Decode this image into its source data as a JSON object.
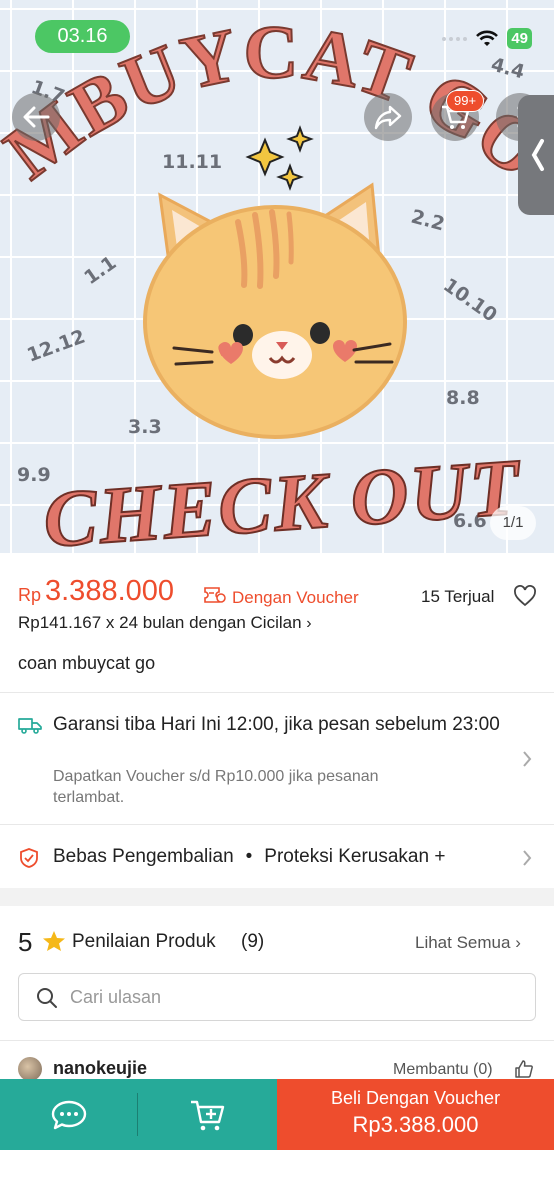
{
  "status_bar": {
    "time": "03.16",
    "battery": "49"
  },
  "hero": {
    "cart_badge": "99+",
    "image_counter": "1/1",
    "artwork_title_top": "MBUYCAT GO",
    "artwork_title_bottom": "CHECK OUT",
    "artwork_dates": [
      "1.1",
      "11.11",
      "2.2",
      "1.1",
      "10.10",
      "12.12",
      "8.8",
      "3.3",
      "9.9",
      "6.6",
      "4.4"
    ]
  },
  "product": {
    "currency": "Rp",
    "price": "3.388.000",
    "voucher_label": "Dengan Voucher",
    "sold": "15 Terjual",
    "installment": "Rp141.167 x 24 bulan dengan Cicilan",
    "name": "coan mbuycat go"
  },
  "shipping": {
    "title": "Garansi tiba Hari Ini 12:00, jika pesan sebelum 23:00",
    "subtitle": "Dapatkan Voucher s/d Rp10.000 jika pesanan terlambat."
  },
  "protection": {
    "return_label": "Bebas Pengembalian",
    "bullet": "•",
    "damage_label": "Proteksi Kerusakan +"
  },
  "reviews": {
    "rating": "5",
    "title": "Penilaian Produk",
    "count": "(9)",
    "see_all": "Lihat Semua",
    "search_placeholder": "Cari ulasan",
    "first_reviewer": "nanokeujie",
    "helpful": "Membantu (0)"
  },
  "bottom_bar": {
    "buy_label": "Beli Dengan Voucher",
    "buy_price": "Rp3.388.000"
  },
  "colors": {
    "accent": "#ee4d2d",
    "teal": "#26aa99",
    "status_green": "#4cc764"
  }
}
